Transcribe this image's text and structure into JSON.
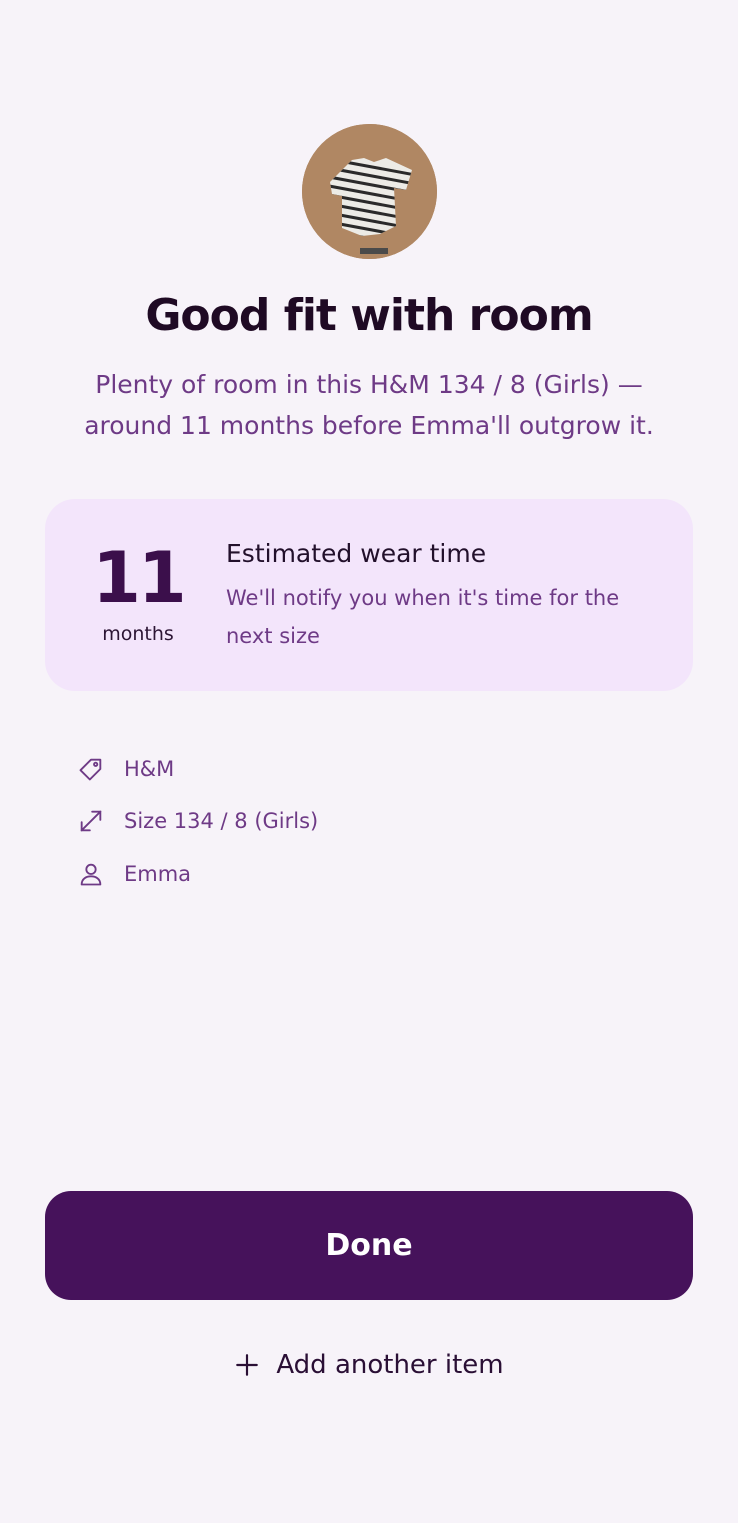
{
  "header": {
    "image": {
      "icon": "striped-shirt-photo"
    },
    "title": "Good fit with room",
    "subtitle": "Plenty of room in this H&M 134 / 8 (Girls) — around 11 months before Emma'll outgrow it."
  },
  "wear_card": {
    "value": "11",
    "unit": "months",
    "heading": "Estimated wear time",
    "description": "We'll notify you when it's time for the next size"
  },
  "details": [
    {
      "icon": "tag-icon",
      "text": "H&M"
    },
    {
      "icon": "resize-icon",
      "text": "Size 134 / 8 (Girls)"
    },
    {
      "icon": "person-icon",
      "text": "Emma"
    }
  ],
  "actions": {
    "done_label": "Done",
    "add_label": "Add another item"
  },
  "colors": {
    "background": "#f7f3f9",
    "primary": "#46125b",
    "accent_text": "#6e3a86",
    "card": "#f3e5fb"
  }
}
